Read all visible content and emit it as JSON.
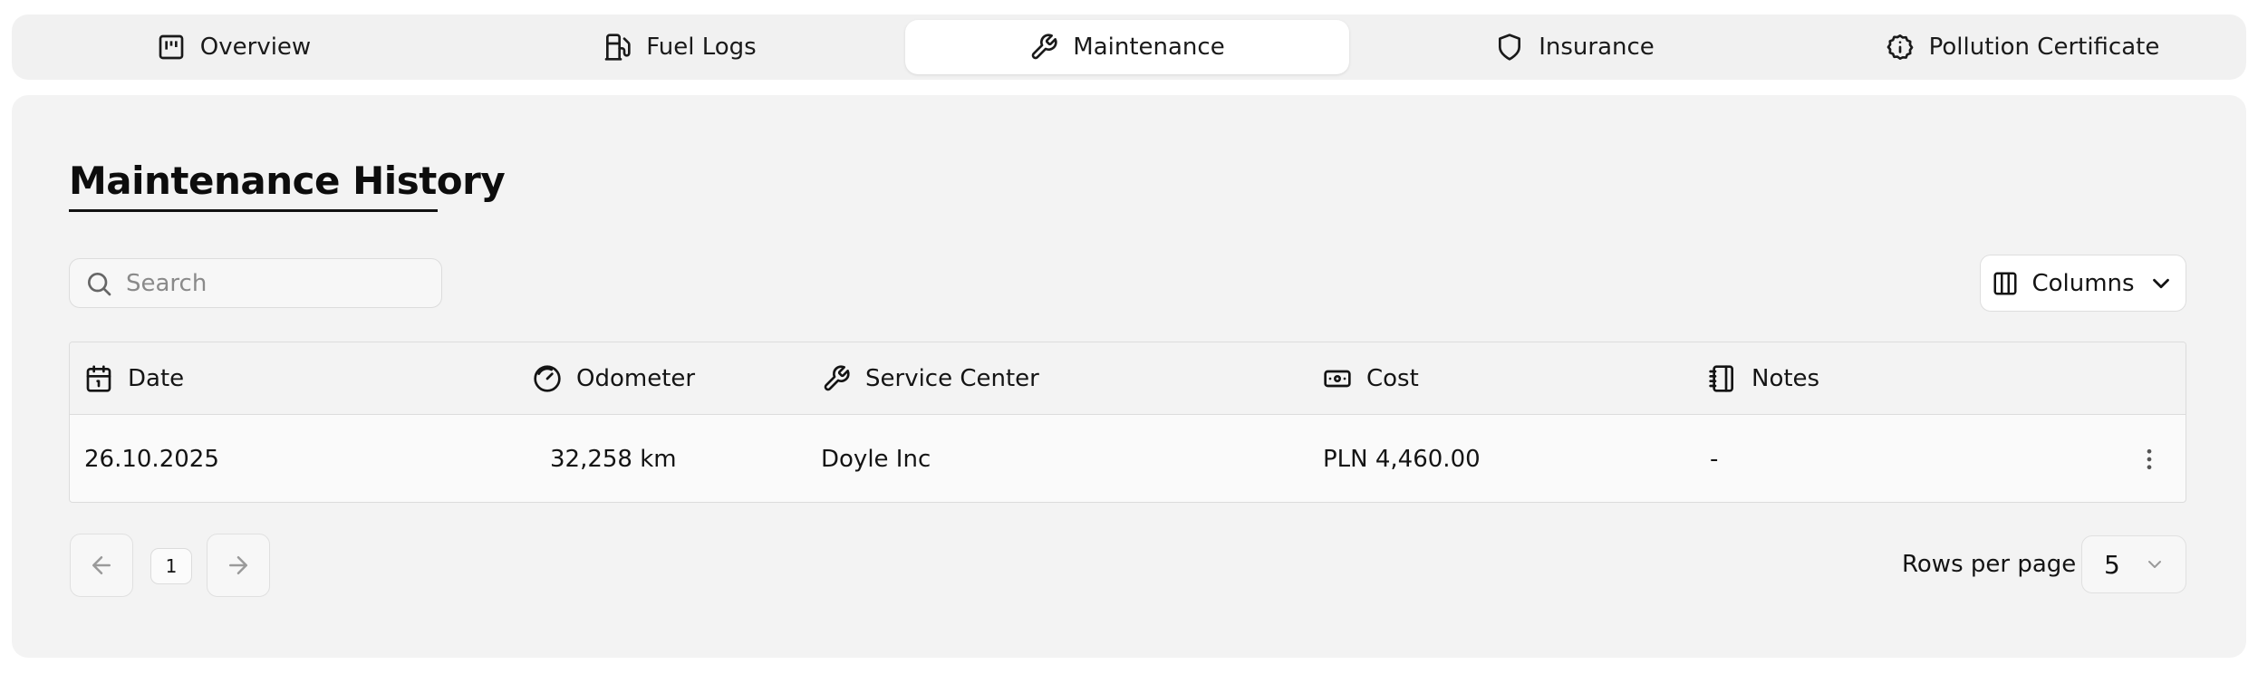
{
  "tabs": [
    {
      "label": "Overview",
      "icon": "overview-icon",
      "active": false
    },
    {
      "label": "Fuel Logs",
      "icon": "fuel-pump-icon",
      "active": false
    },
    {
      "label": "Maintenance",
      "icon": "wrench-icon",
      "active": true
    },
    {
      "label": "Insurance",
      "icon": "shield-icon",
      "active": false
    },
    {
      "label": "Pollution Certificate",
      "icon": "info-badge-icon",
      "active": false
    }
  ],
  "page": {
    "title": "Maintenance History"
  },
  "search": {
    "placeholder": "Search",
    "value": ""
  },
  "columns_button": {
    "label": "Columns"
  },
  "table": {
    "headers": [
      {
        "label": "Date",
        "icon": "calendar-icon"
      },
      {
        "label": "Odometer",
        "icon": "gauge-icon"
      },
      {
        "label": "Service Center",
        "icon": "wrench-icon"
      },
      {
        "label": "Cost",
        "icon": "banknote-icon"
      },
      {
        "label": "Notes",
        "icon": "notebook-icon"
      }
    ],
    "rows": [
      {
        "date": "26.10.2025",
        "odometer": "32,258 km",
        "service_center": "Doyle Inc",
        "cost": "PLN 4,460.00",
        "notes": "-"
      }
    ]
  },
  "pagination": {
    "current_page": "1",
    "rows_per_page_label": "Rows per page",
    "rows_per_page_value": "5"
  },
  "colors": {
    "accent": "#141414",
    "card_bg": "#f3f3f3",
    "tab_bar_bg": "#f1f1f1",
    "border": "#dcdcdc"
  }
}
